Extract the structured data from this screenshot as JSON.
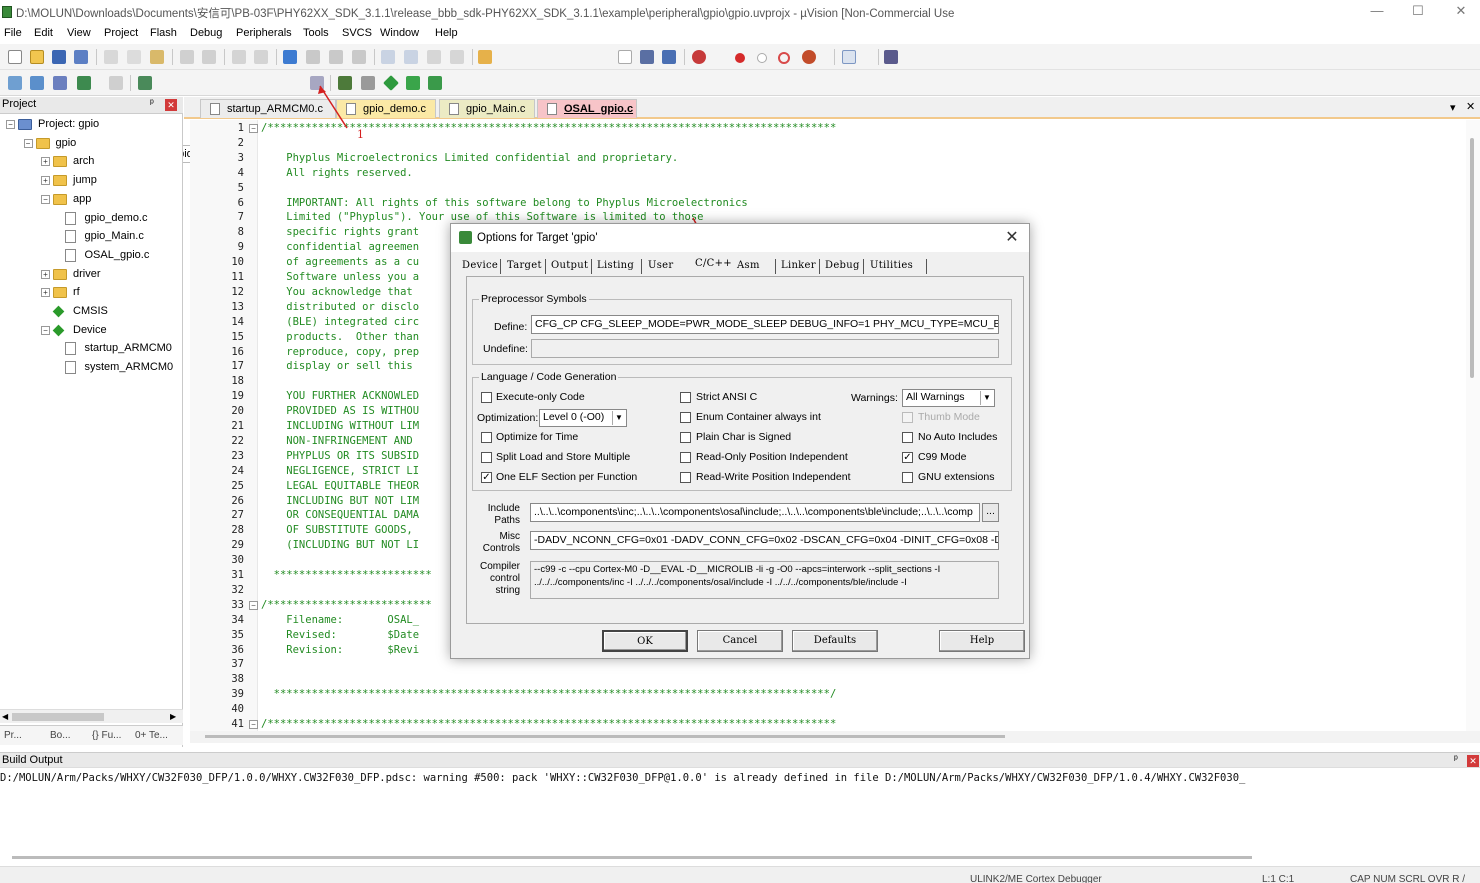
{
  "window": {
    "title": "D:\\MOLUN\\Downloads\\Documents\\安信可\\PB-03F\\PHY62XX_SDK_3.1.1\\release_bbb_sdk-PHY62XX_SDK_3.1.1\\example\\peripheral\\gpio\\gpio.uvprojx - µVision  [Non-Commercial Use",
    "minimize": "—",
    "maximize": "☐",
    "close": "✕"
  },
  "menu": [
    "File",
    "Edit",
    "View",
    "Project",
    "Flash",
    "Debug",
    "Peripherals",
    "Tools",
    "SVCS",
    "Window",
    "Help"
  ],
  "toolbar": {
    "target": "gpio",
    "target_dropdown": "▾"
  },
  "project_panel": {
    "title": "Project",
    "pin": "ᵖ",
    "close": "✕",
    "tree": [
      {
        "label": "Project: gpio",
        "indent": 0,
        "type": "root",
        "expander": "−"
      },
      {
        "label": "gpio",
        "indent": 1,
        "type": "folder",
        "expander": "−"
      },
      {
        "label": "arch",
        "indent": 2,
        "type": "folder",
        "expander": "+"
      },
      {
        "label": "jump",
        "indent": 2,
        "type": "folder",
        "expander": "+"
      },
      {
        "label": "app",
        "indent": 2,
        "type": "folder",
        "expander": "−"
      },
      {
        "label": "gpio_demo.c",
        "indent": 3,
        "type": "file",
        "expander": ""
      },
      {
        "label": "gpio_Main.c",
        "indent": 3,
        "type": "file",
        "expander": ""
      },
      {
        "label": "OSAL_gpio.c",
        "indent": 3,
        "type": "file",
        "expander": ""
      },
      {
        "label": "driver",
        "indent": 2,
        "type": "folder",
        "expander": "+"
      },
      {
        "label": "rf",
        "indent": 2,
        "type": "folder",
        "expander": "+"
      },
      {
        "label": "CMSIS",
        "indent": 2,
        "type": "gem",
        "expander": ""
      },
      {
        "label": "Device",
        "indent": 2,
        "type": "gem",
        "expander": "−"
      },
      {
        "label": "startup_ARMCM0",
        "indent": 3,
        "type": "file",
        "expander": ""
      },
      {
        "label": "system_ARMCM0",
        "indent": 3,
        "type": "file",
        "expander": ""
      }
    ],
    "bottom_tabs": [
      "Pr...",
      "Bo...",
      "{} Fu...",
      "0+ Te..."
    ]
  },
  "editor_tabs": [
    {
      "label": "startup_ARMCM0.c",
      "bg": "#ececec"
    },
    {
      "label": "gpio_demo.c",
      "bg": "#fbe9a6"
    },
    {
      "label": "gpio_Main.c",
      "bg": "#ecebc4"
    },
    {
      "label": "OSAL_gpio.c",
      "bg": "#f7c4c8"
    }
  ],
  "editor": {
    "tabs_menu": "▾",
    "tabs_close": "✕",
    "lines": [
      {
        "n": "1",
        "t": "/******************************************************************************************"
      },
      {
        "n": "2",
        "t": ""
      },
      {
        "n": "3",
        "t": "    Phyplus Microelectronics Limited confidential and proprietary."
      },
      {
        "n": "4",
        "t": "    All rights reserved."
      },
      {
        "n": "5",
        "t": ""
      },
      {
        "n": "6",
        "t": "    IMPORTANT: All rights of this software belong to Phyplus Microelectronics"
      },
      {
        "n": "7",
        "t": "    Limited (\"Phyplus\"). Your use of this Software is limited to those"
      },
      {
        "n": "8",
        "t": "    specific rights grant"
      },
      {
        "n": "9",
        "t": "    confidential agreemen"
      },
      {
        "n": "10",
        "t": "    of agreements as a cu"
      },
      {
        "n": "11",
        "t": "    Software unless you a"
      },
      {
        "n": "12",
        "t": "    You acknowledge that"
      },
      {
        "n": "13",
        "t": "    distributed or disclo"
      },
      {
        "n": "14",
        "t": "    (BLE) integrated circ"
      },
      {
        "n": "15",
        "t": "    products.  Other than"
      },
      {
        "n": "16",
        "t": "    reproduce, copy, prep"
      },
      {
        "n": "17",
        "t": "    display or sell this"
      },
      {
        "n": "18",
        "t": ""
      },
      {
        "n": "19",
        "t": "    YOU FURTHER ACKNOWLED"
      },
      {
        "n": "20",
        "t": "    PROVIDED AS IS WITHOU"
      },
      {
        "n": "21",
        "t": "    INCLUDING WITHOUT LIM"
      },
      {
        "n": "22",
        "t": "    NON-INFRINGEMENT AND"
      },
      {
        "n": "23",
        "t": "    PHYPLUS OR ITS SUBSID"
      },
      {
        "n": "24",
        "t": "    NEGLIGENCE, STRICT LI"
      },
      {
        "n": "25",
        "t": "    LEGAL EQUITABLE THEOR"
      },
      {
        "n": "26",
        "t": "    INCLUDING BUT NOT LIM"
      },
      {
        "n": "27",
        "t": "    OR CONSEQUENTIAL DAMA"
      },
      {
        "n": "28",
        "t": "    OF SUBSTITUTE GOODS,"
      },
      {
        "n": "29",
        "t": "    (INCLUDING BUT NOT LI"
      },
      {
        "n": "30",
        "t": ""
      },
      {
        "n": "31",
        "t": "  *************************"
      },
      {
        "n": "32",
        "t": ""
      },
      {
        "n": "33",
        "t": "/**************************"
      },
      {
        "n": "34",
        "t": "    Filename:       OSAL_"
      },
      {
        "n": "35",
        "t": "    Revised:        $Date"
      },
      {
        "n": "36",
        "t": "    Revision:       $Revi"
      },
      {
        "n": "37",
        "t": ""
      },
      {
        "n": "38",
        "t": ""
      },
      {
        "n": "39",
        "t": "  ****************************************************************************************/"
      },
      {
        "n": "40",
        "t": ""
      },
      {
        "n": "41",
        "t": "/******************************************************************************************"
      }
    ]
  },
  "annotations": {
    "n1": "1",
    "n2": "2",
    "n3": "3",
    "color": "#d42020"
  },
  "build_output": {
    "title": "Build Output",
    "pin": "ᵖ",
    "close": "✕",
    "text": "D:/MOLUN/Arm/Packs/WHXY/CW32F030_DFP/1.0.0/WHXY.CW32F030_DFP.pdsc: warning #500: pack 'WHXY::CW32F030_DFP@1.0.0' is already defined in file D:/MOLUN/Arm/Packs/WHXY/CW32F030_DFP/1.0.4/WHXY.CW32F030_"
  },
  "statusbar": {
    "debugger": "ULINK2/ME Cortex Debugger",
    "pos": "L:1 C:1",
    "caps": "CAP  NUM  SCRL  OVR  R /"
  },
  "dialog": {
    "title": "Options for Target 'gpio'",
    "close": "✕",
    "tabs": [
      "Device",
      "Target",
      "Output",
      "Listing",
      "User",
      "C/C++",
      "Asm",
      "Linker",
      "Debug",
      "Utilities"
    ],
    "active_tab": "C/C++",
    "preprocessor": {
      "legend": "Preprocessor Symbols",
      "define_label": "Define:",
      "define_value": "CFG_CP   CFG_SLEEP_MODE=PWR_MODE_SLEEP DEBUG_INFO=1 PHY_MCU_TYPE=MCU_BUMEE",
      "undefine_label": "Undefine:",
      "undefine_value": ""
    },
    "language": {
      "legend": "Language / Code Generation",
      "execute_only": "Execute-only Code",
      "optimization_label": "Optimization:",
      "optimization_value": "Level 0 (-O0)",
      "optimize_time": "Optimize for Time",
      "split_load": "Split Load and Store Multiple",
      "one_elf": "One ELF Section per Function",
      "strict_ansi": "Strict ANSI C",
      "enum_container": "Enum Container always int",
      "plain_char": "Plain Char is Signed",
      "ro_pi": "Read-Only Position Independent",
      "rw_pi": "Read-Write Position Independent",
      "warnings_label": "Warnings:",
      "warnings_value": "All Warnings",
      "thumb_mode": "Thumb Mode",
      "no_auto_includes": "No Auto Includes",
      "c99": "C99 Mode",
      "gnu": "GNU extensions",
      "check_mark": "✓"
    },
    "include_label": "Include\nPaths",
    "include_value": "..\\..\\..\\components\\inc;..\\..\\..\\components\\osal\\include;..\\..\\..\\components\\ble\\include;..\\..\\..\\comp",
    "include_browse": "...",
    "misc_label": "Misc\nControls",
    "misc_value": "-DADV_NCONN_CFG=0x01  -DADV_CONN_CFG=0x02  -DSCAN_CFG=0x04   -DINIT_CFG=0x08  -DE",
    "compiler_label": "Compiler\ncontrol\nstring",
    "compiler_line1": "--c99 -c --cpu Cortex-M0 -D__EVAL -D__MICROLIB -li -g -O0 --apcs=interwork --split_sections -I",
    "compiler_line2": "../../../components/inc -I ../../../components/osal/include -I ../../../components/ble/include -I",
    "buttons": {
      "ok": "OK",
      "cancel": "Cancel",
      "defaults": "Defaults",
      "help": "Help"
    }
  }
}
